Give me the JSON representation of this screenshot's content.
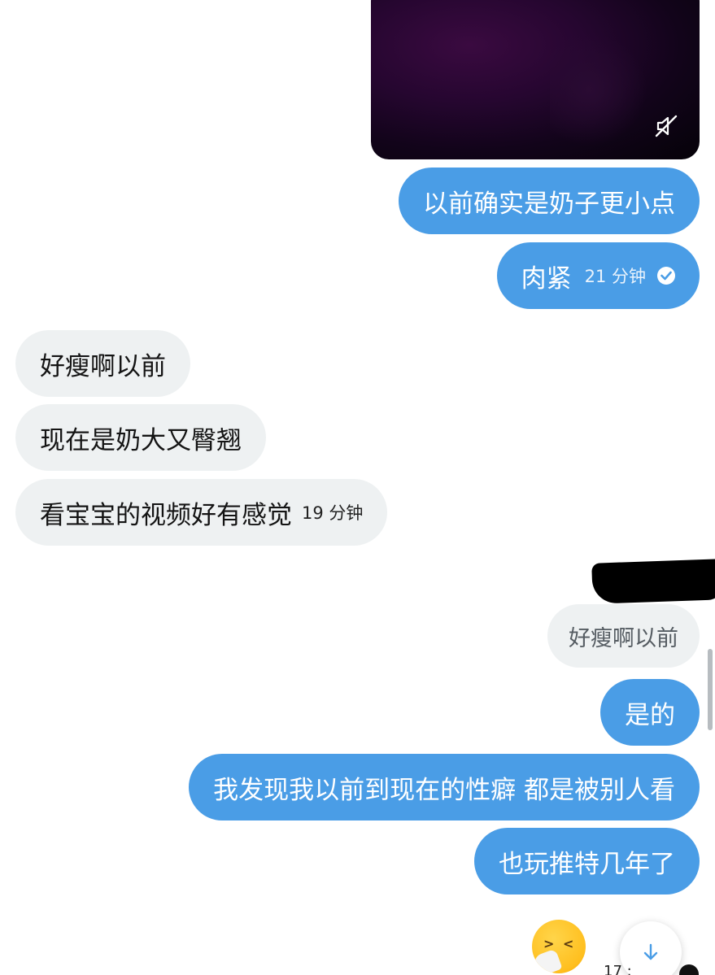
{
  "video": {
    "icon": "muted-speaker-icon"
  },
  "messages": {
    "m1": {
      "text": "以前确实是奶子更小点"
    },
    "m2": {
      "text": "肉紧",
      "time": "21 分钟"
    },
    "m3": {
      "text": "好瘦啊以前"
    },
    "m4": {
      "text": "现在是奶大又臀翘"
    },
    "m5": {
      "text": "看宝宝的视频好有感觉",
      "time": "19 分钟"
    },
    "quote": {
      "text": "好瘦啊以前"
    },
    "m6": {
      "text": "是的"
    },
    "m7": {
      "text": "我发现我以前到现在的性癖 都是被别人看"
    },
    "m8": {
      "text": "也玩推特几年了"
    }
  },
  "bottom": {
    "emoji": "sneezing-face-icon",
    "time_partial": "17 :",
    "scroll_down_icon": "arrow-down-icon"
  },
  "colors": {
    "outgoing": "#4a9de6",
    "incoming": "#eef1f2",
    "text_out": "#ffffff",
    "text_in": "#141414"
  }
}
